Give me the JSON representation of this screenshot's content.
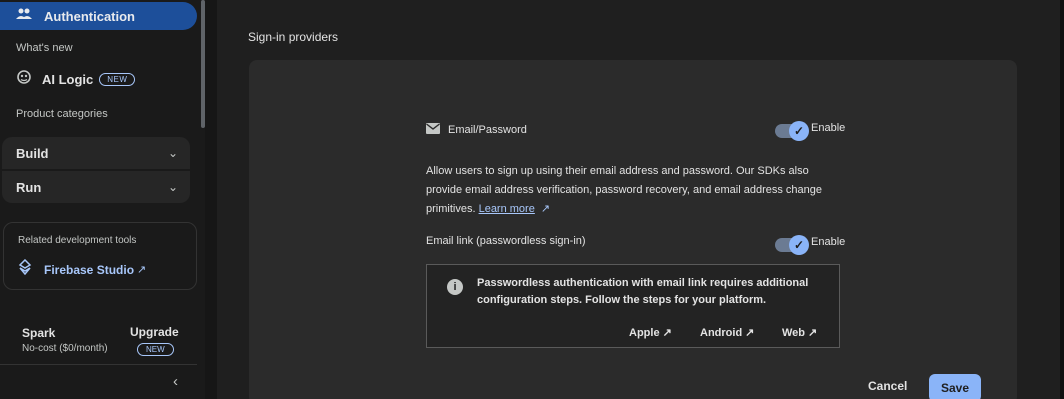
{
  "sidebar": {
    "active_item": "Authentication",
    "whats_new": "What's new",
    "ai_logic": "AI Logic",
    "new_badge": "NEW",
    "product_categories": "Product categories",
    "categories": [
      "Build",
      "Run"
    ],
    "related_tools_title": "Related development tools",
    "firebase_studio": "Firebase Studio",
    "plan_name": "Spark",
    "plan_price": "No-cost ($0/month)",
    "upgrade": "Upgrade",
    "upgrade_badge": "NEW"
  },
  "main": {
    "section_title": "Sign-in providers",
    "provider": "Email/Password",
    "enable_label": "Enable",
    "description": "Allow users to sign up using their email address and password. Our SDKs also provide email address verification, password recovery, and email address change primitives.",
    "learn_more": "Learn more",
    "email_link_label": "Email link (passwordless sign-in)",
    "email_link_enable_label": "Enable",
    "info_text": "Passwordless authentication with email link requires additional configuration steps. Follow the steps for your platform.",
    "platforms": [
      "Apple",
      "Android",
      "Web"
    ],
    "cancel": "Cancel",
    "save": "Save"
  },
  "icons": {
    "auth": "people-icon",
    "ai": "ai-logic-icon",
    "studio": "firebase-studio-icon",
    "mail": "mail-icon",
    "info": "info-icon",
    "external": "external-link-icon"
  },
  "colors": {
    "accent": "#8ab4f8",
    "active_nav": "#1d4f9a",
    "link": "#a8c7fa"
  }
}
